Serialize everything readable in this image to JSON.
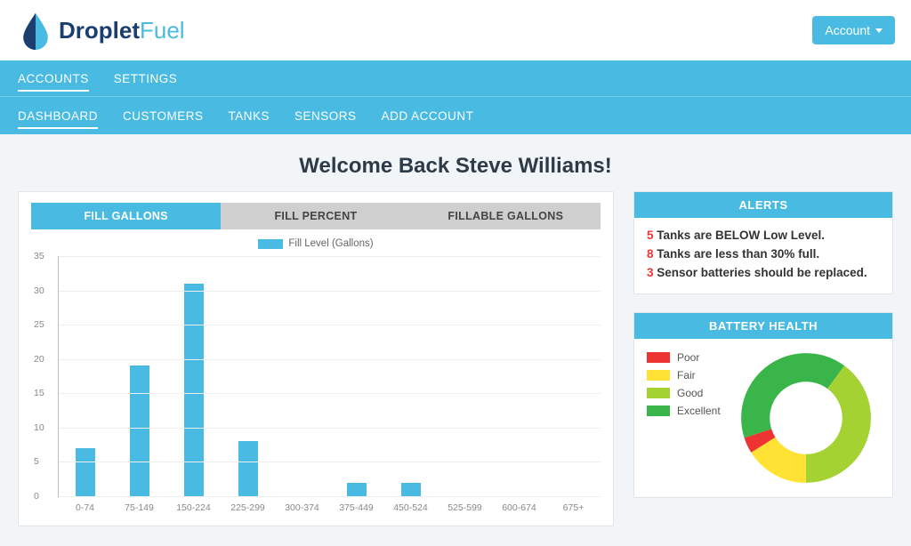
{
  "brand": {
    "part1": "Droplet",
    "part2": "Fuel"
  },
  "account_button": "Account",
  "nav_primary": [
    {
      "label": "ACCOUNTS",
      "active": true
    },
    {
      "label": "SETTINGS",
      "active": false
    }
  ],
  "nav_secondary": [
    {
      "label": "DASHBOARD",
      "active": true
    },
    {
      "label": "CUSTOMERS",
      "active": false
    },
    {
      "label": "TANKS",
      "active": false
    },
    {
      "label": "SENSORS",
      "active": false
    },
    {
      "label": "ADD ACCOUNT",
      "active": false
    }
  ],
  "welcome": "Welcome Back Steve Williams!",
  "tabs": [
    {
      "label": "FILL GALLONS",
      "active": true
    },
    {
      "label": "FILL PERCENT",
      "active": false
    },
    {
      "label": "FILLABLE GALLONS",
      "active": false
    }
  ],
  "alerts": {
    "title": "ALERTS",
    "items": [
      {
        "count": "5",
        "text": " Tanks are BELOW Low Level."
      },
      {
        "count": "8",
        "text": " Tanks are less than 30% full."
      },
      {
        "count": "3",
        "text": " Sensor batteries should be replaced."
      }
    ]
  },
  "battery": {
    "title": "BATTERY HEALTH",
    "legend": [
      {
        "label": "Poor",
        "color": "#e33"
      },
      {
        "label": "Fair",
        "color": "#ffe234"
      },
      {
        "label": "Good",
        "color": "#a4d233"
      },
      {
        "label": "Excellent",
        "color": "#39b54a"
      }
    ],
    "slices_pct": {
      "poor": 4,
      "fair": 16,
      "good": 40,
      "excellent": 40
    }
  },
  "chart_data": {
    "type": "bar",
    "title": "",
    "legend_label": "Fill Level (Gallons)",
    "xlabel": "",
    "ylabel": "",
    "ylim": [
      0,
      35
    ],
    "yticks": [
      0,
      5,
      10,
      15,
      20,
      25,
      30,
      35
    ],
    "categories": [
      "0-74",
      "75-149",
      "150-224",
      "225-299",
      "300-374",
      "375-449",
      "450-524",
      "525-599",
      "600-674",
      "675+"
    ],
    "values": [
      7,
      19,
      31,
      8,
      0,
      2,
      2,
      0,
      0,
      0
    ]
  }
}
